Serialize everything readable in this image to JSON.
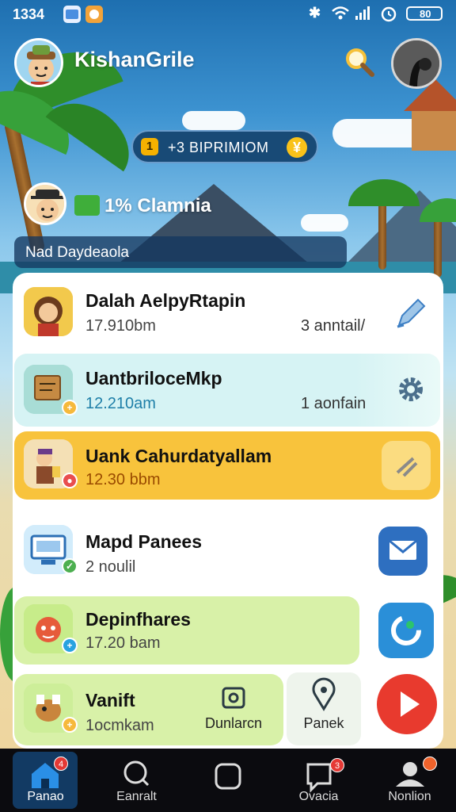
{
  "status_bar": {
    "time": "1334",
    "icons": [
      "photo-app-icon",
      "app-icon",
      "bluetooth-icon",
      "wifi-icon",
      "signal-icon",
      "alarm-icon",
      "battery-icon"
    ],
    "battery": "80"
  },
  "header": {
    "title": "KishanGrile"
  },
  "banner": {
    "badge": "1",
    "text": "+3 BIPRIMIOM",
    "coin": "¥"
  },
  "companion": {
    "text": "1% Clamnia"
  },
  "section": {
    "label": "Nad Daydeaola"
  },
  "items": [
    {
      "title": "Dalah AelpyRtapin",
      "time": "17.910bm",
      "meta": "3 anntail/",
      "action_icon": "pencil-icon"
    },
    {
      "title": "UantbriloceMkp",
      "time": "12.210am",
      "meta": "1 aonfain",
      "action_icon": "gear-icon"
    },
    {
      "title": "Uank Cahurdatyallam",
      "time": "12.30 bbm",
      "meta": "",
      "action_icon": "edit-lines-icon"
    },
    {
      "title": "Mapd Panees",
      "time": "2 noulil",
      "meta": "",
      "action_icon": "mail-icon"
    },
    {
      "title": "Depinfhares",
      "time": "17.20 bam",
      "meta": "",
      "action_icon": "refresh-icon"
    },
    {
      "title": "Vanift",
      "time": "1ocmkam",
      "meta": "",
      "action_icon": "play-icon"
    }
  ],
  "inline_actions": {
    "camera_label": "Dunlarcn",
    "location_label": "Panek"
  },
  "colors": {
    "accent_yellow": "#f8c33c",
    "nav_active": "#2a8fe6",
    "play_red": "#e83a2e"
  },
  "nav": [
    {
      "label": "Panao",
      "badge": "4"
    },
    {
      "label": "Eanralt"
    },
    {
      "label": ""
    },
    {
      "label": "Ovacia",
      "badge": "3"
    },
    {
      "label": "Nonlion",
      "badge": ""
    }
  ]
}
